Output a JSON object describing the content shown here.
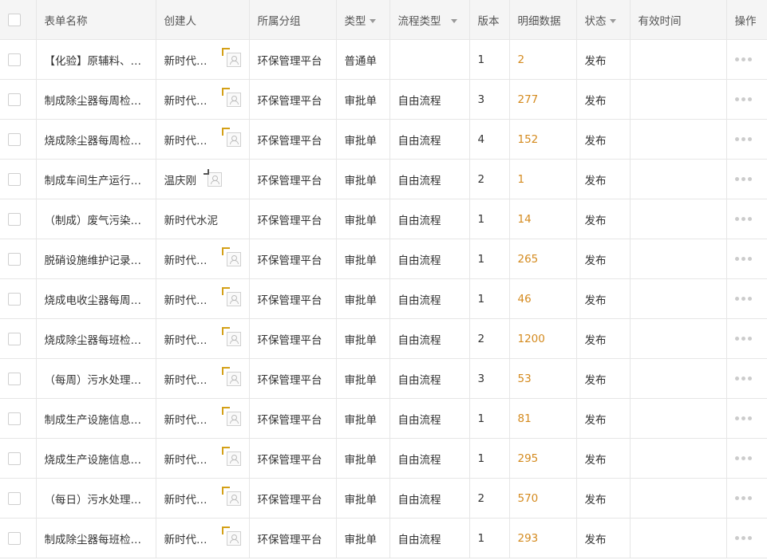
{
  "header": {
    "form_name": "表单名称",
    "creator": "创建人",
    "group": "所属分组",
    "type": "类型",
    "flow_type": "流程类型",
    "version": "版本",
    "detail": "明细数据",
    "status": "状态",
    "valid_time": "有效时间",
    "operation": "操作"
  },
  "rows": [
    {
      "form_name": "【化验】原辅料、…",
      "creator": "新时代…",
      "group": "环保管理平台",
      "type": "普通单",
      "flow_type": "",
      "version": "1",
      "detail": "2",
      "status": "发布",
      "valid_time": ""
    },
    {
      "form_name": "制成除尘器每周检…",
      "creator": "新时代…",
      "group": "环保管理平台",
      "type": "审批单",
      "flow_type": "自由流程",
      "version": "3",
      "detail": "277",
      "status": "发布",
      "valid_time": ""
    },
    {
      "form_name": "烧成除尘器每周检…",
      "creator": "新时代…",
      "group": "环保管理平台",
      "type": "审批单",
      "flow_type": "自由流程",
      "version": "4",
      "detail": "152",
      "status": "发布",
      "valid_time": ""
    },
    {
      "form_name": "制成车间生产运行…",
      "creator": "温庆刚",
      "group": "环保管理平台",
      "type": "审批单",
      "flow_type": "自由流程",
      "version": "2",
      "detail": "1",
      "status": "发布",
      "valid_time": ""
    },
    {
      "form_name": "（制成）废气污染…",
      "creator": "新时代水泥",
      "group": "环保管理平台",
      "type": "审批单",
      "flow_type": "自由流程",
      "version": "1",
      "detail": "14",
      "status": "发布",
      "valid_time": ""
    },
    {
      "form_name": "脱硝设施维护记录…",
      "creator": "新时代…",
      "group": "环保管理平台",
      "type": "审批单",
      "flow_type": "自由流程",
      "version": "1",
      "detail": "265",
      "status": "发布",
      "valid_time": ""
    },
    {
      "form_name": "烧成电收尘器每周…",
      "creator": "新时代…",
      "group": "环保管理平台",
      "type": "审批单",
      "flow_type": "自由流程",
      "version": "1",
      "detail": "46",
      "status": "发布",
      "valid_time": ""
    },
    {
      "form_name": "烧成除尘器每班检…",
      "creator": "新时代…",
      "group": "环保管理平台",
      "type": "审批单",
      "flow_type": "自由流程",
      "version": "2",
      "detail": "1200",
      "status": "发布",
      "valid_time": ""
    },
    {
      "form_name": "（每周）污水处理…",
      "creator": "新时代…",
      "group": "环保管理平台",
      "type": "审批单",
      "flow_type": "自由流程",
      "version": "3",
      "detail": "53",
      "status": "发布",
      "valid_time": ""
    },
    {
      "form_name": "制成生产设施信息…",
      "creator": "新时代…",
      "group": "环保管理平台",
      "type": "审批单",
      "flow_type": "自由流程",
      "version": "1",
      "detail": "81",
      "status": "发布",
      "valid_time": ""
    },
    {
      "form_name": "烧成生产设施信息…",
      "creator": "新时代…",
      "group": "环保管理平台",
      "type": "审批单",
      "flow_type": "自由流程",
      "version": "1",
      "detail": "295",
      "status": "发布",
      "valid_time": ""
    },
    {
      "form_name": "（每日）污水处理…",
      "creator": "新时代…",
      "group": "环保管理平台",
      "type": "审批单",
      "flow_type": "自由流程",
      "version": "2",
      "detail": "570",
      "status": "发布",
      "valid_time": ""
    },
    {
      "form_name": "制成除尘器每班检…",
      "creator": "新时代…",
      "group": "环保管理平台",
      "type": "审批单",
      "flow_type": "自由流程",
      "version": "1",
      "detail": "293",
      "status": "发布",
      "valid_time": ""
    }
  ],
  "colors": {
    "detail_number": "#d48a1e",
    "avatar_arrow": "#d4a017",
    "header_bg": "#f5f5f5",
    "border": "#e6e6e6"
  },
  "icons": {
    "creator_avatar": "person-avatar-icon",
    "row_more": "more-dots-icon"
  }
}
